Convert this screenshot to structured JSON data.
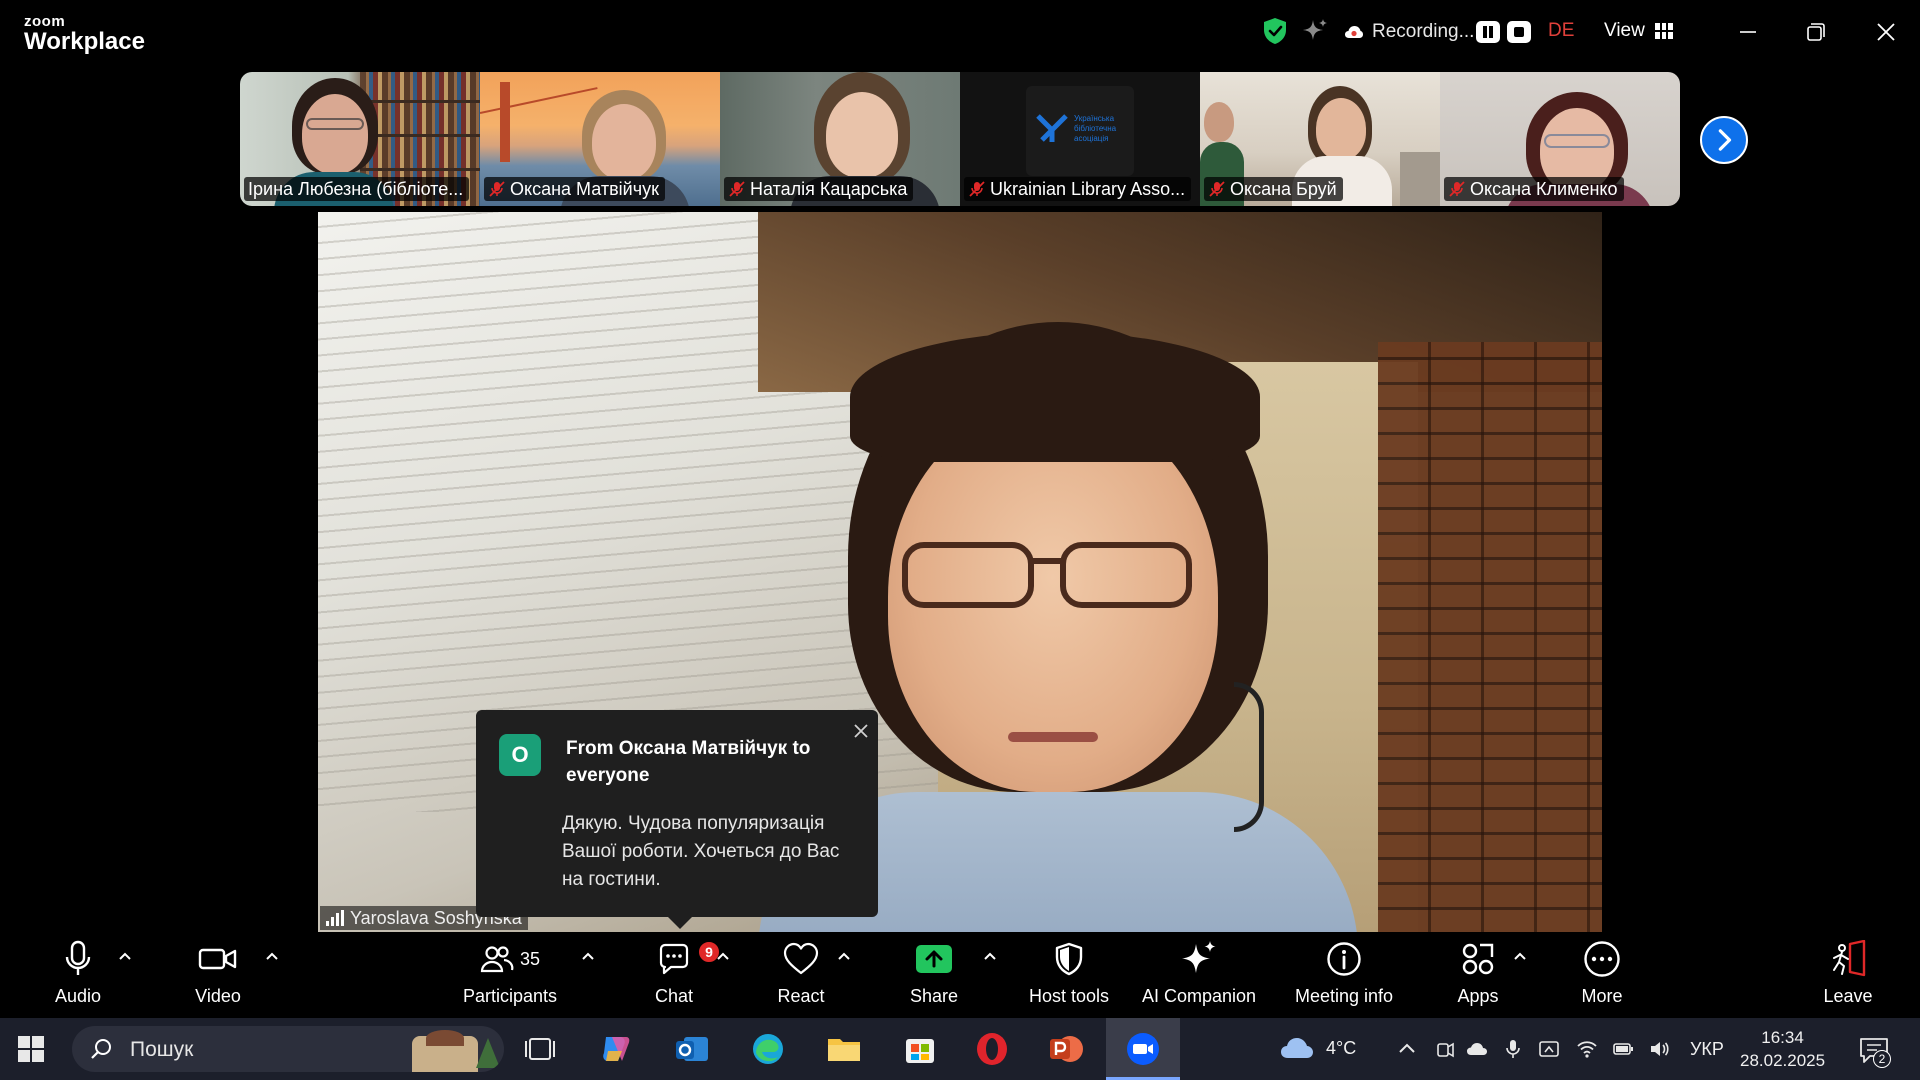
{
  "app": {
    "logo_top": "zoom",
    "logo_bottom": "Workplace",
    "recording_label": "Recording...",
    "language": "DE",
    "view_label": "View"
  },
  "thumbnails": [
    {
      "name": "Ірина Любезна (бібліоте..."
    },
    {
      "name": "Оксана Матвійчук"
    },
    {
      "name": "Наталія Кацарська"
    },
    {
      "name": "Ukrainian Library Asso..."
    },
    {
      "name": "Оксана Бруй"
    },
    {
      "name": "Оксана Клименко"
    }
  ],
  "thumbnail_logo": {
    "line1": "Українська",
    "line2": "бібліотечна",
    "line3": "асоціація"
  },
  "main_speaker": {
    "name": "Yaroslava Soshynska"
  },
  "chat_popup": {
    "avatar_letter": "O",
    "title": "From Оксана Матвійчук to everyone",
    "message": "Дякую. Чудова популяризація Вашої роботи.  Хочеться до Вас на гостини."
  },
  "toolbar": {
    "audio": "Audio",
    "video": "Video",
    "participants": "Participants",
    "participants_count": "35",
    "chat": "Chat",
    "chat_badge": "9",
    "react": "React",
    "share": "Share",
    "host_tools": "Host tools",
    "ai_companion": "AI Companion",
    "meeting_info": "Meeting info",
    "apps": "Apps",
    "more": "More",
    "leave": "Leave"
  },
  "taskbar": {
    "search_placeholder": "Пошук",
    "weather": "4°C",
    "keyboard_lang": "УКР",
    "time": "16:34",
    "date": "28.02.2025",
    "notification_count": "2"
  },
  "colors": {
    "accent_blue": "#0e71eb",
    "recording_red": "#e0403a",
    "chat_avatar": "#1a9f78",
    "share_green": "#22c55e",
    "leave_red": "#e02828",
    "shield_green": "#22c55e"
  }
}
